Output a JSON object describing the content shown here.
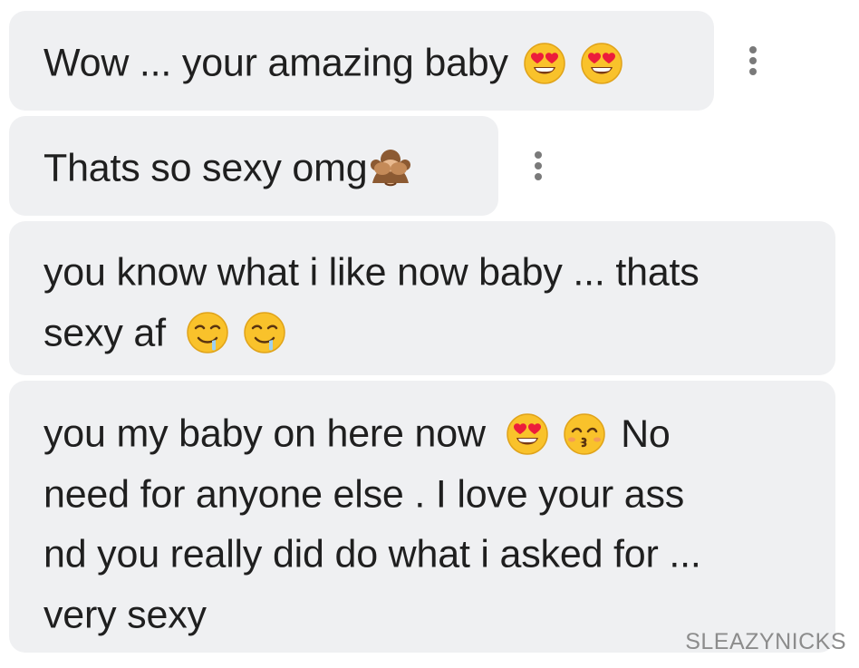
{
  "messages": [
    {
      "lines": [
        {
          "text": "Wow ... your amazing baby",
          "emojis": [
            "heart-eyes-icon",
            "heart-eyes-icon"
          ]
        }
      ]
    },
    {
      "lines": [
        {
          "text": "Thats so sexy omg",
          "emojis": [
            "see-no-evil-monkey-icon"
          ]
        }
      ]
    },
    {
      "lines": [
        {
          "text": "you know what i like now baby ... thats",
          "emojis": []
        },
        {
          "text": "sexy af",
          "emojis": [
            "drooling-face-icon",
            "drooling-face-icon"
          ]
        }
      ]
    },
    {
      "lines": [
        {
          "text": "you my baby on here now",
          "emojis": [
            "heart-eyes-icon",
            "kissing-smiling-eyes-icon"
          ],
          "after": "No"
        },
        {
          "text": "need for anyone else . I love your ass",
          "emojis": []
        },
        {
          "text": "nd you really did do what i asked for ...",
          "emojis": []
        },
        {
          "text": "very sexy",
          "emojis": []
        }
      ]
    }
  ],
  "watermark": "SLEAZYNICKS"
}
